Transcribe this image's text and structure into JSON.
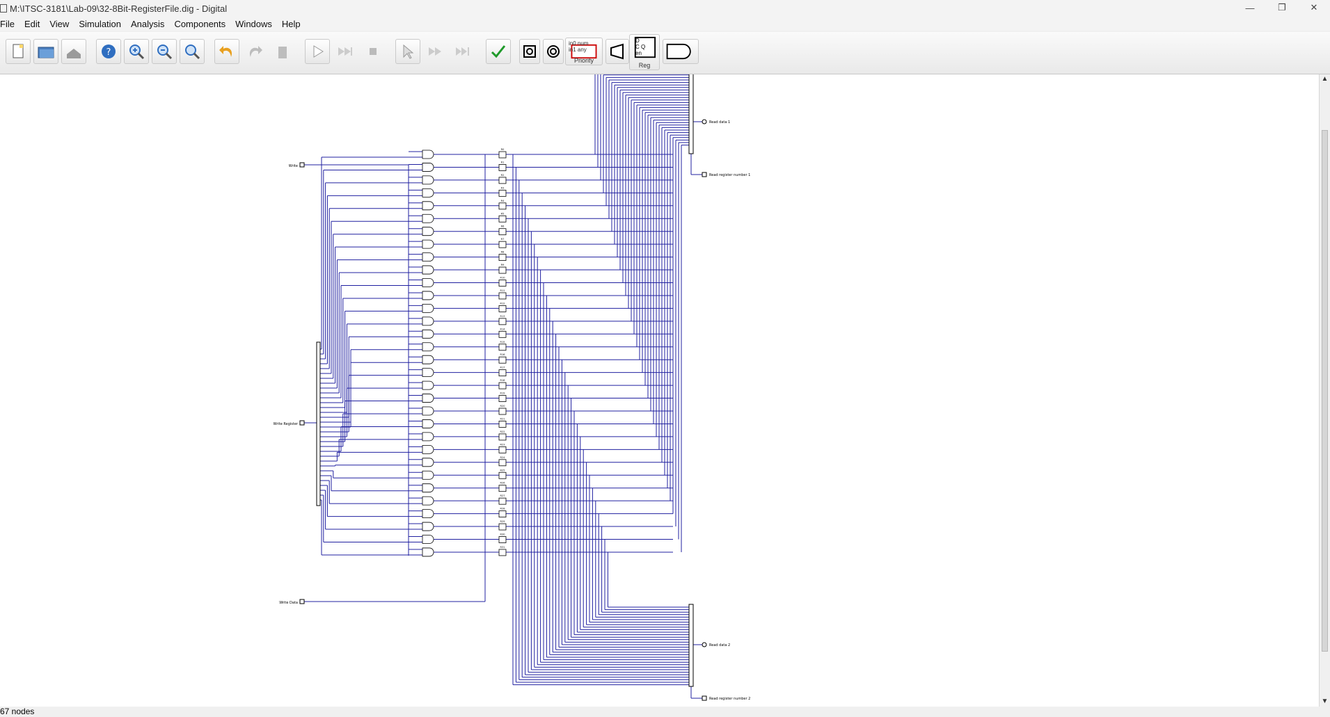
{
  "window": {
    "title": "M:\\ITSC-3181\\Lab-09\\32-8Bit-RegisterFile.dig - Digital",
    "controls": {
      "minimize": "—",
      "restore": "❐",
      "close": "✕"
    }
  },
  "menu": [
    "File",
    "Edit",
    "View",
    "Simulation",
    "Analysis",
    "Components",
    "Windows",
    "Help"
  ],
  "toolbar": {
    "buttons": [
      "new-icon",
      "open-icon",
      "save-icon",
      "help-icon",
      "zoom-in-icon",
      "zoom-out-icon",
      "zoom-fit-icon",
      "undo-icon",
      "redo-icon",
      "delete-icon",
      "run-icon",
      "step-icon",
      "stop-icon",
      "select-step-icon",
      "fast-forward-icon",
      "skip-icon",
      "analysis-check-icon",
      "probe-icon",
      "clock-icon",
      "priority-encoder-icon",
      "demux-icon",
      "register-icon",
      "and-gate-icon"
    ],
    "priority_label": "Priority",
    "priority_lines": [
      "in0 num",
      "in1 any"
    ],
    "register_label": "Reg",
    "register_pins": [
      "D",
      "C  Q",
      "en"
    ]
  },
  "circuit": {
    "inputs": {
      "write": "Write",
      "write_register": "Write Register",
      "write_data": "Write Data"
    },
    "outputs": {
      "read_data_1": "Read data 1",
      "read_register_1": "Read register number 1",
      "read_data_2": "Read data 2",
      "read_register_2": "Read register number 2"
    },
    "register_count": 32,
    "register_labels": [
      "R0",
      "R1",
      "R2",
      "R3",
      "R4",
      "R5",
      "R6",
      "R7",
      "R8",
      "R9",
      "R10",
      "R11",
      "R12",
      "R13",
      "R14",
      "R15",
      "R16",
      "R17",
      "R18",
      "R19",
      "R20",
      "R21",
      "R22",
      "R23",
      "R24",
      "R25",
      "R26",
      "R27",
      "R28",
      "R29",
      "R30",
      "R31"
    ],
    "wire_color": "#2020a0"
  },
  "status": "67 nodes"
}
